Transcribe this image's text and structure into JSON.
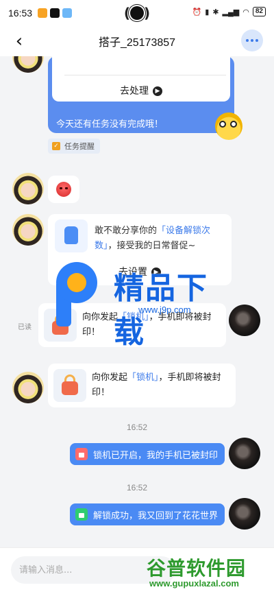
{
  "status_bar": {
    "time": "16:53",
    "battery": "82"
  },
  "nav": {
    "title": "搭子_25173857"
  },
  "messages": {
    "task_card": {
      "action_label": "去处理",
      "tip": "今天还有任务没有完成哦！"
    },
    "reminder_label": "任务提醒",
    "share_card": {
      "text_before": "敢不敢分享你的",
      "text_highlight": "「设备解锁次数」",
      "text_after": "，接受我的日常督促~",
      "action_label": "去设置"
    },
    "read_label": "已读",
    "lock_sent": {
      "text_before": "向你发起",
      "text_highlight": "「锁机」",
      "text_after": "，手机即将被封印！"
    },
    "lock_received": {
      "text_before": "向你发起",
      "text_highlight": "「锁机」",
      "text_after": "，手机即将被封印！"
    },
    "time_1": "16:52",
    "status_locked": "锁机已开启，我的手机已被封印",
    "time_2": "16:52",
    "status_unlocked": "解锁成功，我又回到了花花世界"
  },
  "watermark_top": {
    "title": "精品下载",
    "url": "www.j9p.com"
  },
  "input": {
    "placeholder": "请输入消息..."
  },
  "watermark_bottom": {
    "name": "谷普软件园",
    "url": "www.gupuxlazal.com"
  },
  "colors": {
    "accent": "#4a8af4",
    "link": "#3d7bea",
    "lock_red": "#ff6b6b",
    "unlock_green": "#2ecc71"
  }
}
